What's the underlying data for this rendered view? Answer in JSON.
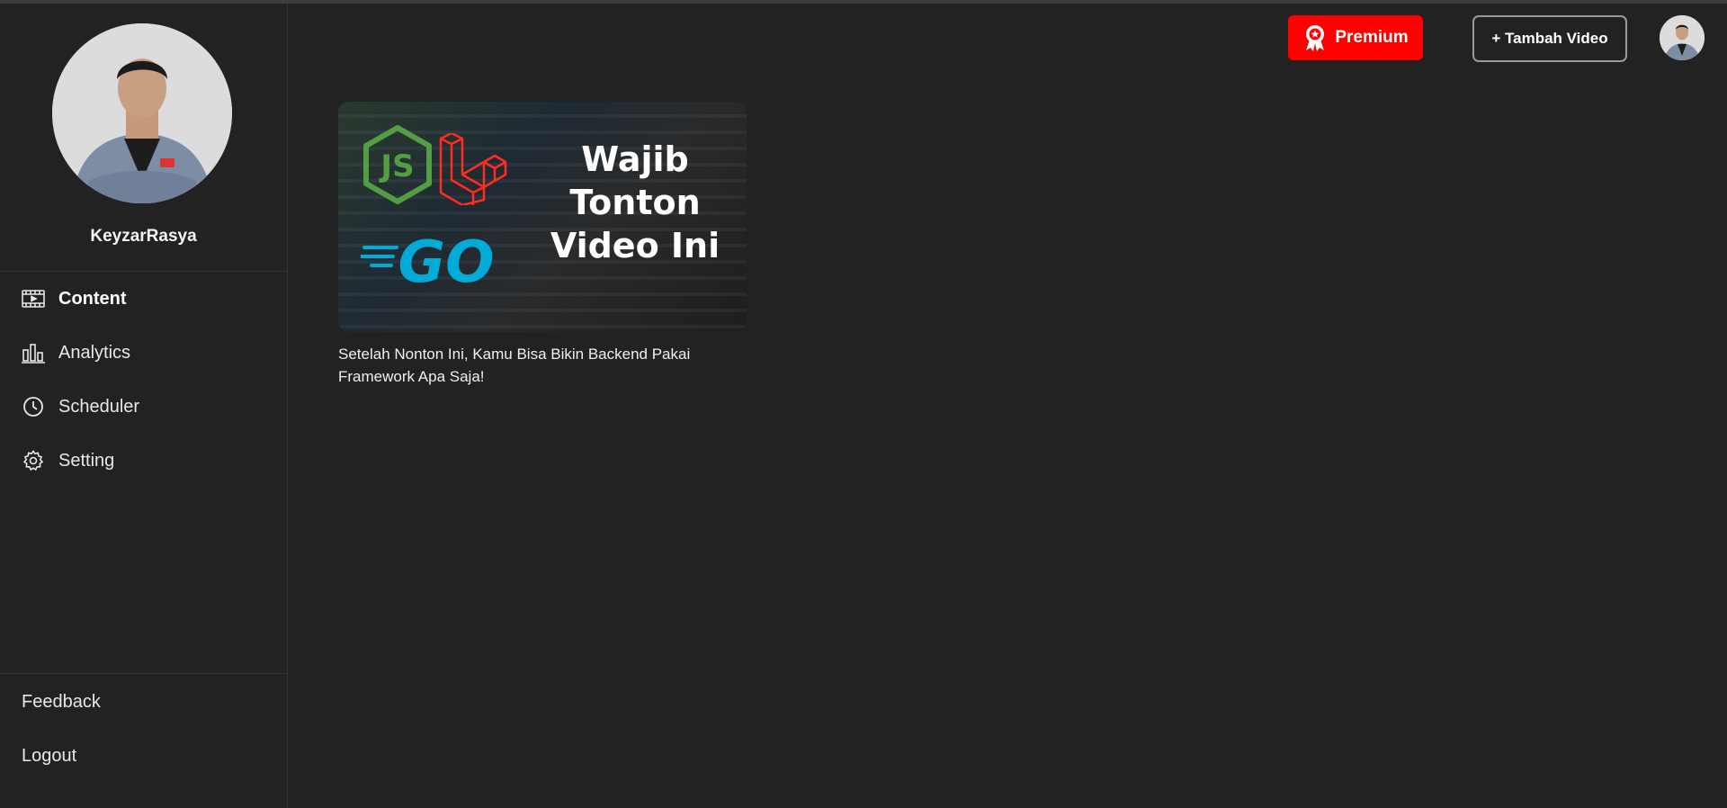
{
  "profile": {
    "username": "KeyzarRasya"
  },
  "nav": [
    {
      "label": "Content",
      "icon": "film-icon",
      "active": true
    },
    {
      "label": "Analytics",
      "icon": "bar-chart-icon",
      "active": false
    },
    {
      "label": "Scheduler",
      "icon": "clock-icon",
      "active": false
    },
    {
      "label": "Setting",
      "icon": "gear-icon",
      "active": false
    }
  ],
  "bottom_links": {
    "feedback": "Feedback",
    "logout": "Logout"
  },
  "header": {
    "premium_label": "Premium",
    "add_video_label": "+ Tambah Video"
  },
  "colors": {
    "background": "#222222",
    "premium": "#ff0000",
    "node_green": "#539e43",
    "laravel_red": "#ff2d20",
    "go_blue": "#00acd7"
  },
  "videos": [
    {
      "thumbnail_lines": [
        "Wajib",
        "Tonton",
        "Video Ini"
      ],
      "thumbnail_logos": [
        "JS",
        "GO"
      ],
      "title": "Setelah Nonton Ini, Kamu Bisa Bikin Backend Pakai Framework Apa Saja!"
    }
  ]
}
